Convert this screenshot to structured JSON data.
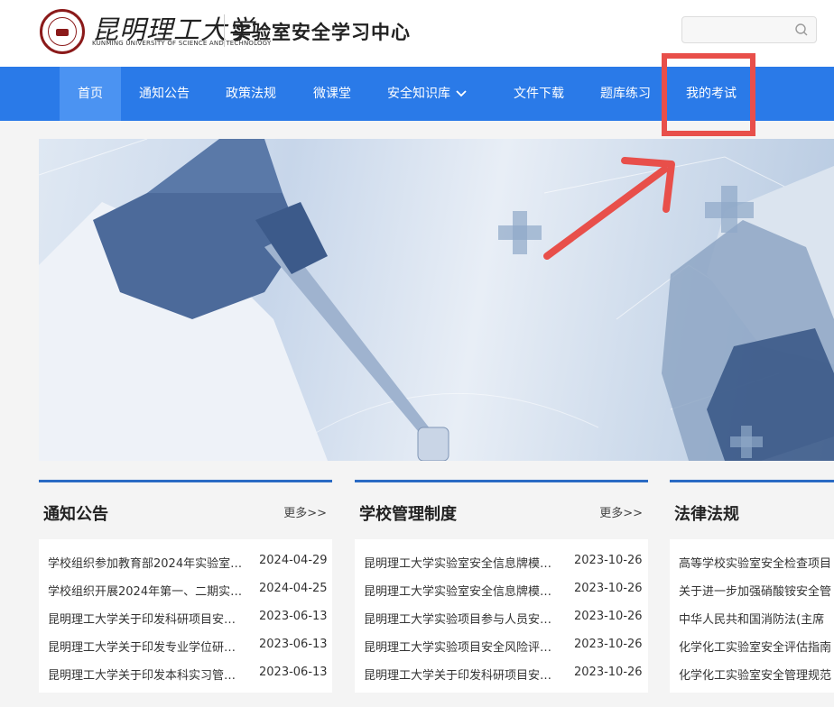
{
  "header": {
    "logo_cn": "昆明理工大学",
    "logo_en": "KUNMING UNIVERSITY OF SCIENCE AND TECHNOLOGY",
    "site_title": "实验室安全学习中心",
    "search_placeholder": ""
  },
  "nav": {
    "items": [
      {
        "label": "首页"
      },
      {
        "label": "通知公告"
      },
      {
        "label": "政策法规"
      },
      {
        "label": "微课堂"
      },
      {
        "label": "安全知识库"
      },
      {
        "label": "文件下载"
      },
      {
        "label": "题库练习"
      },
      {
        "label": "我的考试"
      }
    ]
  },
  "colors": {
    "nav_bg": "#2a7ae8",
    "nav_active": "#4b93f2",
    "annotation_red": "#e84f4a",
    "panel_accent": "#2a6ac4"
  },
  "panels": [
    {
      "title": "通知公告",
      "more": "更多>>",
      "items": [
        {
          "title": "学校组织参加教育部2024年实验室…",
          "date": "2024-04-29"
        },
        {
          "title": "学校组织开展2024年第一、二期实…",
          "date": "2024-04-25"
        },
        {
          "title": "昆明理工大学关于印发科研项目安…",
          "date": "2023-06-13"
        },
        {
          "title": "昆明理工大学关于印发专业学位研…",
          "date": "2023-06-13"
        },
        {
          "title": "昆明理工大学关于印发本科实习管…",
          "date": "2023-06-13"
        }
      ]
    },
    {
      "title": "学校管理制度",
      "more": "更多>>",
      "items": [
        {
          "title": "昆明理工大学实验室安全信息牌模…",
          "date": "2023-10-26"
        },
        {
          "title": "昆明理工大学实验室安全信息牌模…",
          "date": "2023-10-26"
        },
        {
          "title": "昆明理工大学实验项目参与人员安…",
          "date": "2023-10-26"
        },
        {
          "title": "昆明理工大学实验项目安全风险评…",
          "date": "2023-10-26"
        },
        {
          "title": "昆明理工大学关于印发科研项目安…",
          "date": "2023-10-26"
        }
      ]
    },
    {
      "title": "法律法规",
      "more": "",
      "items": [
        {
          "title": "高等学校实验室安全检查项目",
          "date": ""
        },
        {
          "title": "关于进一步加强硝酸铵安全管",
          "date": ""
        },
        {
          "title": "中华人民共和国消防法(主席",
          "date": ""
        },
        {
          "title": "化学化工实验室安全评估指南",
          "date": ""
        },
        {
          "title": "化学化工实验室安全管理规范",
          "date": ""
        }
      ]
    }
  ]
}
